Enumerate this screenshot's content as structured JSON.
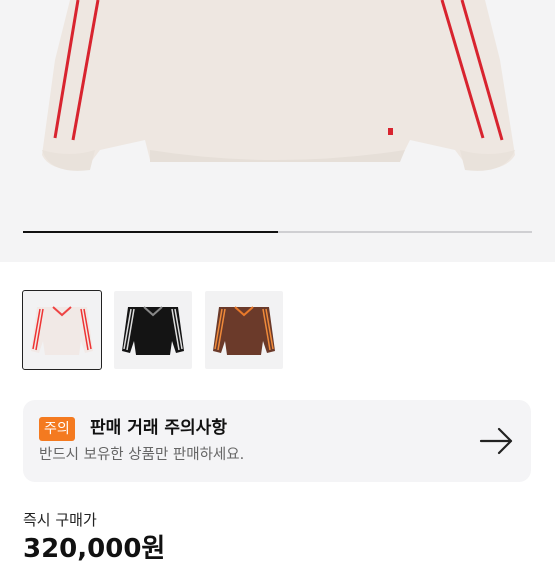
{
  "product_image": {
    "alt": "sweater-photo",
    "carousel_progress": 0.5
  },
  "thumbnails": [
    {
      "name": "cream-red-stripe",
      "selected": true
    },
    {
      "name": "black-white-stripe",
      "selected": false
    },
    {
      "name": "brown-stripe",
      "selected": false
    }
  ],
  "notice": {
    "badge": "주의",
    "title": "판매 거래 주의사항",
    "subtitle": "반드시 보유한 상품만 판매하세요.",
    "icon": "arrow-right-icon"
  },
  "price": {
    "label": "즉시 구매가",
    "value": "320,000원"
  },
  "colors": {
    "badge": "#f47a20",
    "stripe_red": "#d8242f"
  }
}
